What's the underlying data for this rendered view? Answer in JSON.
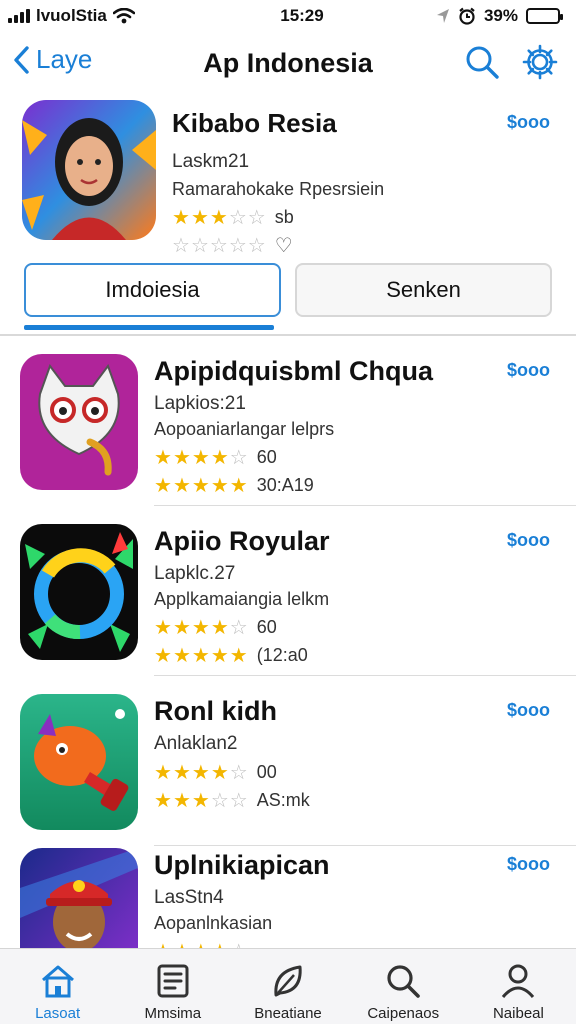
{
  "status": {
    "carrier": "lvuolStia",
    "time": "15:29",
    "battery": "39%",
    "battery_level": 0.85
  },
  "nav": {
    "back_label": "Laye",
    "title": "Ap Indonesia"
  },
  "featured": {
    "title": "Kibabo Resia",
    "subtitle": "Laskm21",
    "description": "Ramarahokake Rpesrsiein",
    "rating": 3.5,
    "rating_text": "sb",
    "rating2": 0,
    "price": "$ooo"
  },
  "tabs": [
    {
      "label": "Imdoiesia",
      "active": true
    },
    {
      "label": "Senken",
      "active": false
    }
  ],
  "apps": [
    {
      "title": "Apipidquisbml Chqua",
      "subtitle": "Lapkios:21",
      "description": "Aopoaniarlangar lelprs",
      "rating": 4.5,
      "rating_text": "60",
      "rating2": 5,
      "rating2_text": "30:A19",
      "price": "$ooo"
    },
    {
      "title": "Apiio Royular",
      "subtitle": "Lapklc.27",
      "description": "Applkamaiangia lelkm",
      "rating": 4.5,
      "rating_text": "60",
      "rating2": 5,
      "rating2_text": "(12:a0",
      "price": "$ooo"
    },
    {
      "title": "Ronl kidh",
      "subtitle": "Anlaklan2",
      "description": "",
      "rating": 4.5,
      "rating_text": "00",
      "rating2": 3,
      "rating2_text": "AS:mk",
      "price": "$ooo"
    },
    {
      "title": "Uplnikiapican",
      "subtitle": "LasStn4",
      "description": "Aopanlnkasian",
      "rating": 4,
      "rating_text": "",
      "rating2": 0,
      "rating2_text": "",
      "price": "$ooo"
    }
  ],
  "tabbar": [
    {
      "label": "Lasoat",
      "icon": "home-icon",
      "active": true
    },
    {
      "label": "Mmsima",
      "icon": "list-icon",
      "active": false
    },
    {
      "label": "Bneatiane",
      "icon": "leaf-icon",
      "active": false
    },
    {
      "label": "Caipenaos",
      "icon": "search-icon",
      "active": false
    },
    {
      "label": "Naibeal",
      "icon": "person-icon",
      "active": false
    }
  ],
  "colors": {
    "accent": "#1a7fd6",
    "star": "#f3b600"
  }
}
